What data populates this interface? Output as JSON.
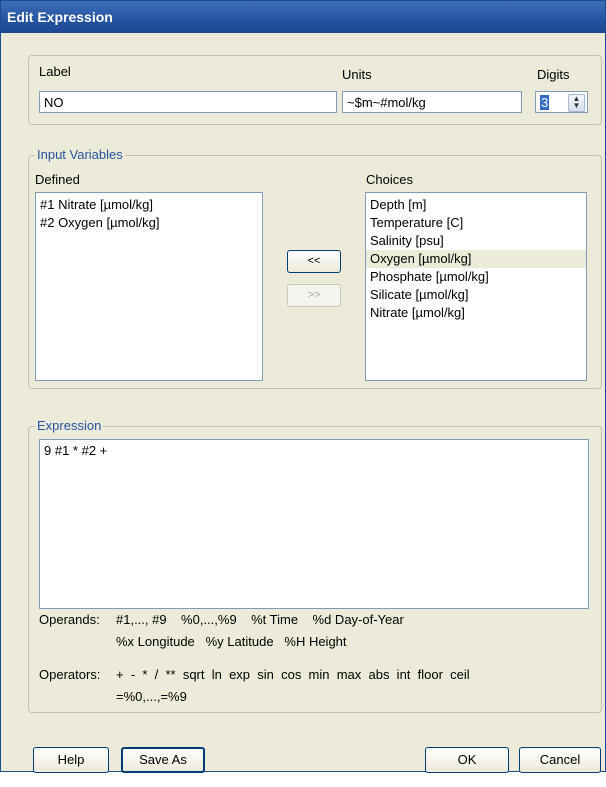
{
  "window": {
    "title": "Edit Expression"
  },
  "label_field": {
    "label": "Label",
    "value": "NO"
  },
  "units_field": {
    "label": "Units",
    "value": "~$m~#mol/kg"
  },
  "digits_field": {
    "label": "Digits",
    "value": "3"
  },
  "input_variables": {
    "title": "Input Variables",
    "defined_label": "Defined",
    "defined": [
      "#1 Nitrate [µmol/kg]",
      "#2 Oxygen [µmol/kg]"
    ],
    "choices_label": "Choices",
    "choices": [
      "Depth [m]",
      "Temperature [C]",
      "Salinity [psu]",
      "Oxygen [µmol/kg]",
      "Phosphate [µmol/kg]",
      "Silicate [µmol/kg]",
      "Nitrate [µmol/kg]"
    ],
    "selected_choice": "Oxygen [µmol/kg]",
    "add_button": "<<",
    "remove_button": ">>"
  },
  "expression": {
    "title": "Expression",
    "value": "9 #1 * #2 +",
    "operands_label": "Operands:",
    "operands_line1": "#1,..., #9    %0,...,%9    %t Time    %d Day-of-Year",
    "operands_line2": "%x Longitude   %y Latitude   %H Height",
    "operators_label": "Operators:",
    "operators_line1": "+  -  *  /  **  sqrt  ln  exp  sin  cos  min  max  abs  int  floor  ceil",
    "operators_line2": "=%0,...,=%9"
  },
  "buttons": {
    "help": "Help",
    "save_as": "Save As",
    "ok": "OK",
    "cancel": "Cancel"
  }
}
